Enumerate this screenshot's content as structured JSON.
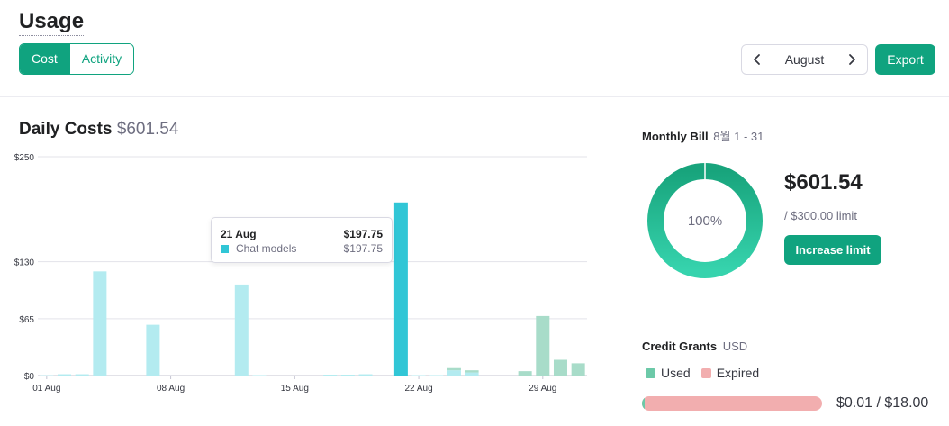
{
  "header": {
    "title": "Usage",
    "tabs": [
      {
        "label": "Cost",
        "active": true
      },
      {
        "label": "Activity",
        "active": false
      }
    ],
    "month": "August",
    "prev_icon": "chevron-left-icon",
    "next_icon": "chevron-right-icon",
    "export_label": "Export"
  },
  "daily": {
    "title": "Daily Costs",
    "total": "$601.54"
  },
  "tooltip": {
    "date": "21 Aug",
    "total": "$197.75",
    "series_name": "Chat models",
    "series_value": "$197.75"
  },
  "chart_data": {
    "type": "bar",
    "title": "Daily Costs",
    "y_ticks": [
      "$250",
      "$130",
      "$65",
      "$0"
    ],
    "y_tick_values": [
      250,
      130,
      65,
      0
    ],
    "ylim": [
      0,
      250
    ],
    "x_tick_labels": [
      "01 Aug",
      "08 Aug",
      "15 Aug",
      "22 Aug",
      "29 Aug"
    ],
    "x_tick_days": [
      1,
      8,
      15,
      22,
      29
    ],
    "days": [
      1,
      2,
      3,
      4,
      5,
      6,
      7,
      8,
      9,
      10,
      11,
      12,
      13,
      14,
      15,
      16,
      17,
      18,
      19,
      20,
      21,
      22,
      23,
      24,
      25,
      26,
      27,
      28,
      29,
      30,
      31
    ],
    "series": [
      {
        "color": "#b3ebf0",
        "highlight_color": "#31c6d6",
        "values": [
          0.4,
          1.5,
          1.5,
          119,
          0,
          0,
          58,
          0,
          0,
          0,
          0,
          104,
          0.5,
          0,
          0,
          0,
          1,
          1,
          1.5,
          0,
          197.75,
          0.5,
          0.5,
          6,
          3.5,
          0,
          0,
          0,
          0,
          0,
          0
        ]
      },
      {
        "color": "#a8dcc9",
        "values": [
          0,
          0,
          0,
          0,
          0,
          0,
          0,
          0,
          0,
          0,
          0,
          0,
          0,
          0,
          0,
          0,
          0,
          0,
          0,
          0,
          0,
          0,
          0,
          2.5,
          2.5,
          0,
          0,
          5,
          68,
          18,
          14
        ]
      }
    ],
    "highlight_day": 21,
    "grid": true
  },
  "bill": {
    "title": "Monthly Bill",
    "range": "8월 1 - 31",
    "percent_label": "100%",
    "percent": 1.0,
    "amount": "$601.54",
    "limit": "/ $300.00 limit",
    "increase_label": "Increase limit",
    "ring_colors": [
      "#18a47c",
      "#36d3ad"
    ]
  },
  "grants": {
    "title": "Credit Grants",
    "unit": "USD",
    "legend": [
      {
        "label": "Used",
        "color": "#6cc9a8"
      },
      {
        "label": "Expired",
        "color": "#f2aeaf"
      }
    ],
    "used_fraction": 0.0006,
    "amount": "$0.01 / $18.00"
  }
}
